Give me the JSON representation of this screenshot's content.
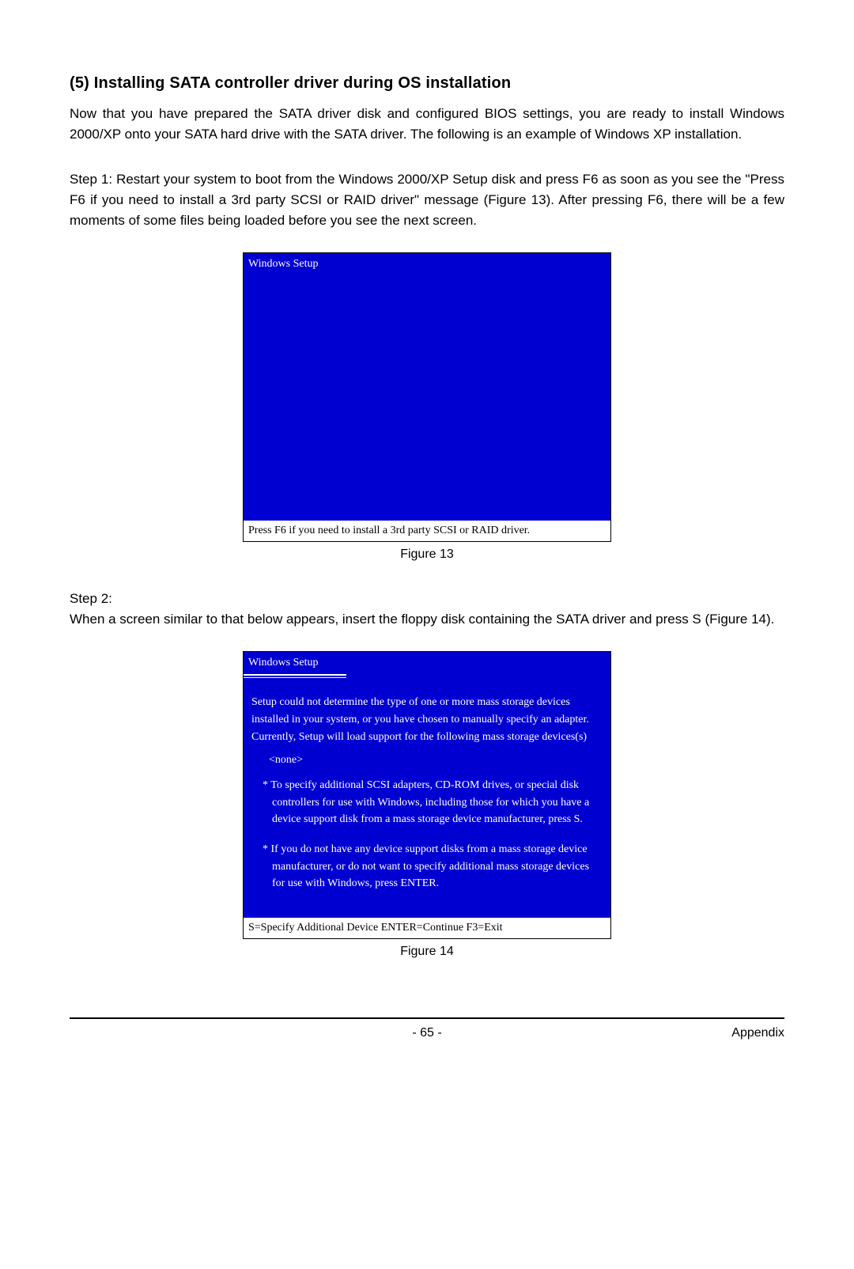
{
  "section": {
    "title": "(5)  Installing SATA controller driver during OS installation",
    "intro": "Now that you have prepared the SATA driver disk and configured BIOS settings, you are ready to install Windows 2000/XP onto your SATA hard drive with the SATA driver. The following is an example of Windows XP installation.",
    "step1": "Step 1: Restart your system to boot from the Windows 2000/XP Setup disk and press F6 as soon as you see the \"Press F6 if you need to install a 3rd party SCSI or RAID driver\" message (Figure 13).  After pressing F6, there will be a few moments of some files being loaded before you see the next screen.",
    "step2_label": "Step 2:",
    "step2_body": "When a screen similar to that below appears, insert the floppy disk containing the SATA driver and press S (Figure 14)."
  },
  "fig13": {
    "title": "Windows Setup",
    "footer": "Press F6 if you need to install  a 3rd party SCSI or RAID driver.",
    "caption": "Figure 13"
  },
  "fig14": {
    "title": "Windows Setup",
    "body1": "Setup could not determine the type of one or more mass storage devices installed in your system, or you have chosen to manually specify an adapter. Currently, Setup will load support for the following mass storage devices(s)",
    "none": "<none>",
    "bullet1": "* To specify additional SCSI adapters, CD-ROM drives, or special disk  controllers for use with Windows, including those for which you have a device support disk from a mass storage device manufacturer, press S.",
    "bullet2": "* If you do not have any device support disks from a mass storage device manufacturer, or do not want to specify additional mass storage devices for use with Windows, press ENTER.",
    "footer": "S=Specify Additional Device   ENTER=Continue   F3=Exit",
    "caption": "Figure 14"
  },
  "footer": {
    "page": "- 65 -",
    "section": "Appendix"
  }
}
